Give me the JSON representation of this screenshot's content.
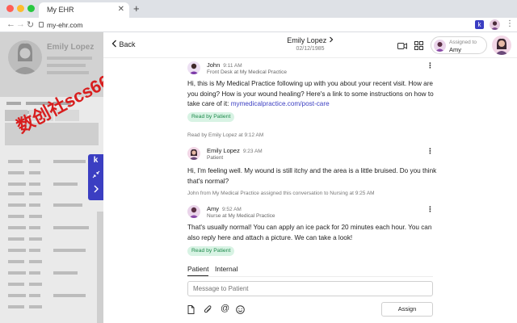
{
  "browser": {
    "tab_title": "My EHR",
    "url": "my-ehr.com",
    "ext_label": "k"
  },
  "ehr": {
    "patient_name": "Emily Lopez"
  },
  "watermark": "数创社scs66",
  "widget": {
    "logo": "k"
  },
  "header": {
    "back_label": "Back",
    "patient_name": "Emily Lopez",
    "dob": "02/12/1985",
    "assigned_label": "Assigned to",
    "assigned_name": "Amy"
  },
  "messages": [
    {
      "name": "John",
      "time": "9:11 AM",
      "role": "Front Desk at My Medical Practice",
      "text": "Hi, this is My Medical Practice following up with you about your recent visit. How are you doing? How is your wound healing? Here's a link to some instructions on how to take care of it: ",
      "link": "mymedicalpractice.com/post-care",
      "badge": "Read by Patient"
    },
    {
      "name": "Emily Lopez",
      "time": "9:23 AM",
      "role": "Patient",
      "text": "Hi, I'm feeling well. My wound is still itchy and the area is a little bruised. Do you think that's normal?"
    },
    {
      "name": "Amy",
      "time": "9:52 AM",
      "role": "Nurse at My Medical Practice",
      "text": "That's usually normal! You can apply an ice pack for 20 minutes each hour. You can also reply here and attach a picture. We can take a look!",
      "badge": "Read by Patient"
    }
  ],
  "system": {
    "read_line": "Read by Emily Lopez at 9:12 AM",
    "assign_line": "John from My Medical Practice assigned this conversation to Nursing at 9:25 AM"
  },
  "composer": {
    "tab_patient": "Patient",
    "tab_internal": "Internal",
    "placeholder": "Message to Patient",
    "assign_label": "Assign"
  },
  "colors": {
    "accent": "#3b3ec2",
    "badge_bg": "#d8f3e4",
    "badge_text": "#1f8a4c",
    "watermark": "#d81e1e"
  }
}
